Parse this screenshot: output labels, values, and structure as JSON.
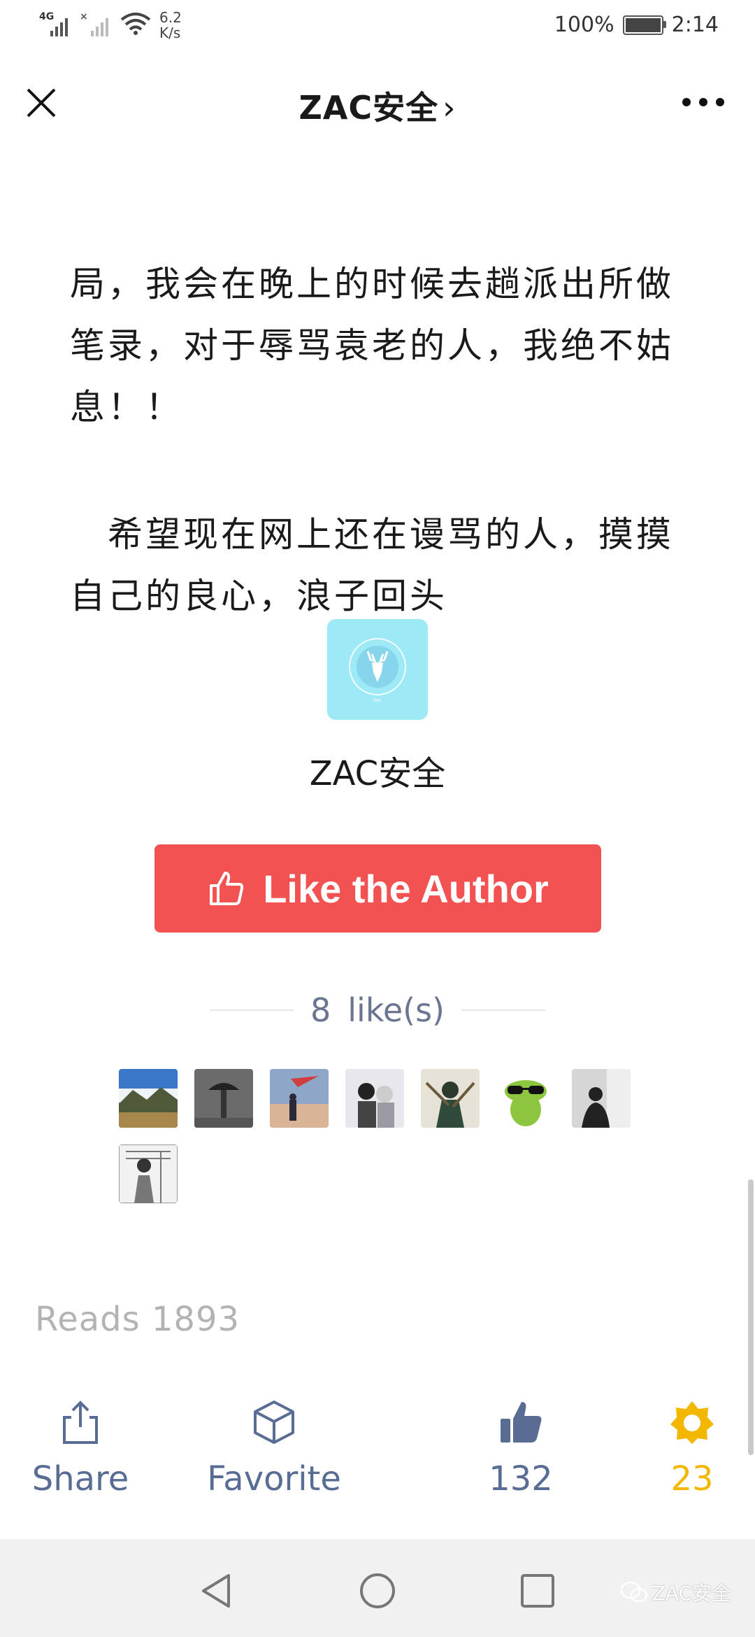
{
  "status_bar": {
    "network_label": "4G",
    "speed_value": "6.2",
    "speed_unit": "K/s",
    "battery_percent": "100%",
    "time": "2:14"
  },
  "navbar": {
    "title": "ZAC安全",
    "chevron": "›"
  },
  "article": {
    "paragraph1_lines": [
      "局，我会在晚上的时候去趟派出所做",
      "笔录，对于辱骂袁老的人，我绝不姑",
      "息！！"
    ],
    "paragraph2_lines": [
      "　希望现在网上还在谩骂的人，摸摸",
      "自己的良心，浪子回头"
    ]
  },
  "author": {
    "name": "ZAC安全",
    "avatar_icon": "deer-logo-icon",
    "avatar_color": "#9ee9f6"
  },
  "like_button": {
    "label": "Like the Author",
    "icon": "thumb-up-outline-icon",
    "color": "#f25352"
  },
  "likes": {
    "count": "8",
    "unit": "like(s)"
  },
  "likers": [
    "avatar-mountain",
    "avatar-umbrella",
    "avatar-kite",
    "avatar-anime-duo",
    "avatar-anime-warrior",
    "avatar-frog-sunglasses",
    "avatar-silhouette",
    "avatar-sketch-girl"
  ],
  "reads": {
    "label": "Reads",
    "count": "1893"
  },
  "actions": {
    "share_label": "Share",
    "favorite_label": "Favorite",
    "like_count": "132",
    "wow_count": "23",
    "accent_color": "#586c94",
    "wow_color": "#f3b700"
  },
  "watermark": {
    "text": "ZAC安全"
  }
}
